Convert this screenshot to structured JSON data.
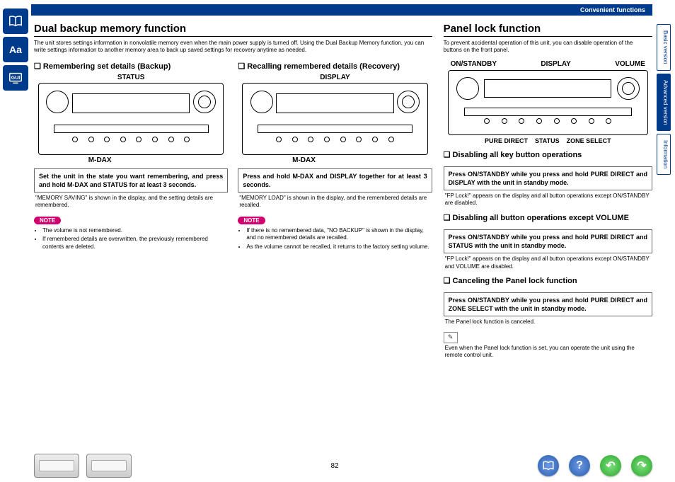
{
  "topbar": {
    "section": "Convenient functions"
  },
  "rightTabs": {
    "t1": "Basic version",
    "t2": "Advanced version",
    "t3": "Information"
  },
  "page": {
    "number": "82"
  },
  "left": {
    "title": "Dual backup memory function",
    "intro": "The unit stores settings information in nonvolatile memory even when the main power supply is turned off. Using the Dual Backup Memory function, you can write settings information to another memory area to back up saved settings for recovery anytime as needed.",
    "backup": {
      "heading": "Remembering set details (Backup)",
      "figTop": "STATUS",
      "figBottom": "M-DAX",
      "instruction": "Set the unit in the state you want remembering, and press and hold M-DAX and STATUS for at least 3 seconds.",
      "after": "\"MEMORY SAVING\" is shown in the display, and the setting details are remembered.",
      "noteLabel": "NOTE",
      "notes": [
        "The volume is not remembered.",
        "If remembered details are overwritten, the previously remembered contents are deleted."
      ]
    },
    "recovery": {
      "heading": "Recalling remembered details (Recovery)",
      "figTop": "DISPLAY",
      "figBottom": "M-DAX",
      "instruction": "Press and hold M-DAX and DISPLAY together for at least 3 seconds.",
      "after": "\"MEMORY LOAD\" is shown in the display, and the remembered details are recalled.",
      "noteLabel": "NOTE",
      "notes": [
        "If there is no remembered data, \"NO BACKUP\" is shown in the display, and no remembered details are recalled.",
        "As the volume cannot be recalled, it returns to the factory setting volume."
      ]
    }
  },
  "right": {
    "title": "Panel lock function",
    "intro": "To prevent accidental operation of this unit, you can disable operation of the buttons on the front panel.",
    "labelsTop": {
      "a": "ON/STANDBY",
      "b": "DISPLAY",
      "c": "VOLUME"
    },
    "labelsBottom": {
      "a": "PURE DIRECT",
      "b": "STATUS",
      "c": "ZONE SELECT"
    },
    "s1": {
      "heading": "Disabling all key button operations",
      "instruction": "Press ON/STANDBY while you press and hold PURE DIRECT and DISPLAY with the unit in standby mode.",
      "after": "\"FP Lock!\" appears on the display and all button operations except ON/STANDBY are disabled."
    },
    "s2": {
      "heading": "Disabling all button operations except VOLUME",
      "instruction": "Press ON/STANDBY while you press and hold PURE DIRECT and STATUS with the unit in standby mode.",
      "after": "\"FP Lock!\" appears on the display and all button operations except ON/STANDBY and VOLUME are disabled."
    },
    "s3": {
      "heading": "Canceling the Panel lock function",
      "instruction": "Press ON/STANDBY while you press and hold PURE DIRECT and ZONE SELECT with the unit in standby mode.",
      "after": "The Panel lock function is canceled."
    },
    "tip": "Even when the Panel lock function is set, you can operate the unit using the remote control unit."
  }
}
